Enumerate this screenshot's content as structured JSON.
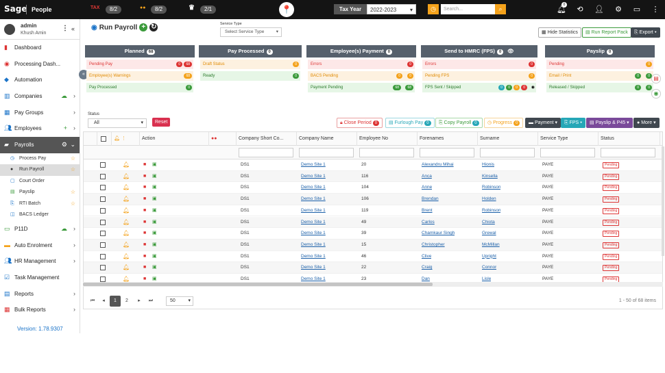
{
  "topbar": {
    "logo": "Sage",
    "app_name": "People",
    "tax_label": "TAX",
    "stats": [
      "8/2",
      "8/2",
      "2/1"
    ],
    "tax_year_label": "Tax Year",
    "tax_year_value": "2022-2023",
    "search_placeholder": "Search...",
    "notifications_count": "0"
  },
  "user": {
    "name": "admin",
    "role": "Khush Amin"
  },
  "nav": {
    "dashboard": "Dashboard",
    "processing": "Processing Dash...",
    "automation": "Automation",
    "companies": "Companies",
    "paygroups": "Pay Groups",
    "employees": "Employees",
    "payrolls": "Payrolls",
    "sub": [
      "Process Pay",
      "Run Payroll",
      "Court Order",
      "Payslip",
      "RTI Batch",
      "BACS Ledger"
    ],
    "p11d": "P11D",
    "autoenrol": "Auto Enrolment",
    "hr": "HR Management",
    "task": "Task Management",
    "reports": "Reports",
    "bulk": "Bulk Reports"
  },
  "version": "Version: 1.78.9307",
  "page": {
    "title": "Run Payroll",
    "service_type_label": "Service Type",
    "service_type_placeholder": "Select Service Type",
    "hide_stats": "Hide Statistics",
    "run_report": "Run Report Pack",
    "export": "Export"
  },
  "cards": [
    {
      "title": "Planned",
      "count": "68",
      "rows": [
        {
          "label": "Pending Pay",
          "badges": [
            "0",
            "68"
          ],
          "tone": "red"
        },
        {
          "label": "Employee(s) Warnings",
          "badges": [
            "68"
          ],
          "tone": "orange"
        },
        {
          "label": "Pay Processed",
          "badges": [
            "0"
          ],
          "tone": "green"
        }
      ]
    },
    {
      "title": "Pay Processed",
      "count": "0",
      "rows": [
        {
          "label": "Draft Status",
          "badges": [
            "0"
          ],
          "tone": "orange"
        },
        {
          "label": "Ready",
          "badges": [
            "0"
          ],
          "tone": "green"
        }
      ]
    },
    {
      "title": "Employee(s) Payment",
      "count": "0",
      "rows": [
        {
          "label": "Errors",
          "badges": [
            "0"
          ],
          "tone": "red"
        },
        {
          "label": "BACS Pending",
          "badges": [
            "0",
            "0"
          ],
          "tone": "orange"
        },
        {
          "label": "Payment Pending",
          "badges": [
            "68",
            "68"
          ],
          "tone": "green"
        }
      ]
    },
    {
      "title": "Send to HMRC (FPS)",
      "count": "0",
      "rows": [
        {
          "label": "Errors",
          "badges": [
            "0"
          ],
          "tone": "red"
        },
        {
          "label": "Pending FPS",
          "badges": [
            "0"
          ],
          "tone": "orange"
        },
        {
          "label": "FPS Sent / Skipped",
          "badges": [
            "0",
            "0",
            "0",
            "0"
          ],
          "tone": "green"
        }
      ]
    },
    {
      "title": "Payslip",
      "count": "0",
      "rows": [
        {
          "label": "Pending",
          "badges": [
            "0"
          ],
          "tone": "red"
        },
        {
          "label": "Email / Print",
          "badges": [
            "0",
            "0"
          ],
          "tone": "orange"
        },
        {
          "label": "Released / Skipped",
          "badges": [
            "0",
            "0"
          ],
          "tone": "green"
        }
      ]
    }
  ],
  "filters": {
    "status_label": "Status",
    "status_value": "All",
    "reset": "Reset",
    "close_period": "Close Period",
    "close_period_count": "0",
    "furlough": "Furlough Pay",
    "furlough_count": "0",
    "copy_payroll": "Copy Payroll",
    "copy_count": "0",
    "progress": "Progress",
    "progress_count": "0",
    "payment": "Payment",
    "fps": "FPS",
    "payslip_p45": "Payslip & P45",
    "more": "More"
  },
  "table": {
    "headers": [
      "Action",
      "Company Short Co...",
      "Company Name",
      "Employee No",
      "Forenames",
      "Surname",
      "Service Type",
      "Status"
    ],
    "rows": [
      [
        "DS1",
        "Demo Site 1",
        "20",
        "Alexandru Mihai",
        "Hionis",
        "PAYE",
        "Pending"
      ],
      [
        "DS1",
        "Demo Site 1",
        "116",
        "Anca",
        "Kinsella",
        "PAYE",
        "Pending"
      ],
      [
        "DS1",
        "Demo Site 1",
        "104",
        "Anne",
        "Robinson",
        "PAYE",
        "Pending"
      ],
      [
        "DS1",
        "Demo Site 1",
        "106",
        "Brendan",
        "Holden",
        "PAYE",
        "Pending"
      ],
      [
        "DS1",
        "Demo Site 1",
        "119",
        "Brent",
        "Robinson",
        "PAYE",
        "Pending"
      ],
      [
        "DS1",
        "Demo Site 1",
        "49",
        "Carlos",
        "Chiota",
        "PAYE",
        "Pending"
      ],
      [
        "DS1",
        "Demo Site 1",
        "39",
        "Chamkaur Singh",
        "Grewal",
        "PAYE",
        "Pending"
      ],
      [
        "DS1",
        "Demo Site 1",
        "15",
        "Christopher",
        "McMillan",
        "PAYE",
        "Pending"
      ],
      [
        "DS1",
        "Demo Site 1",
        "46",
        "Clive",
        "Upright",
        "PAYE",
        "Pending"
      ],
      [
        "DS1",
        "Demo Site 1",
        "22",
        "Craig",
        "Connor",
        "PAYE",
        "Pending"
      ],
      [
        "DS1",
        "Demo Site 1",
        "23",
        "Dan",
        "Lisle",
        "PAYE",
        "Pending"
      ]
    ]
  },
  "pager": {
    "pages": [
      "1",
      "2"
    ],
    "size": "50",
    "info": "1 - 50 of 68 items"
  }
}
